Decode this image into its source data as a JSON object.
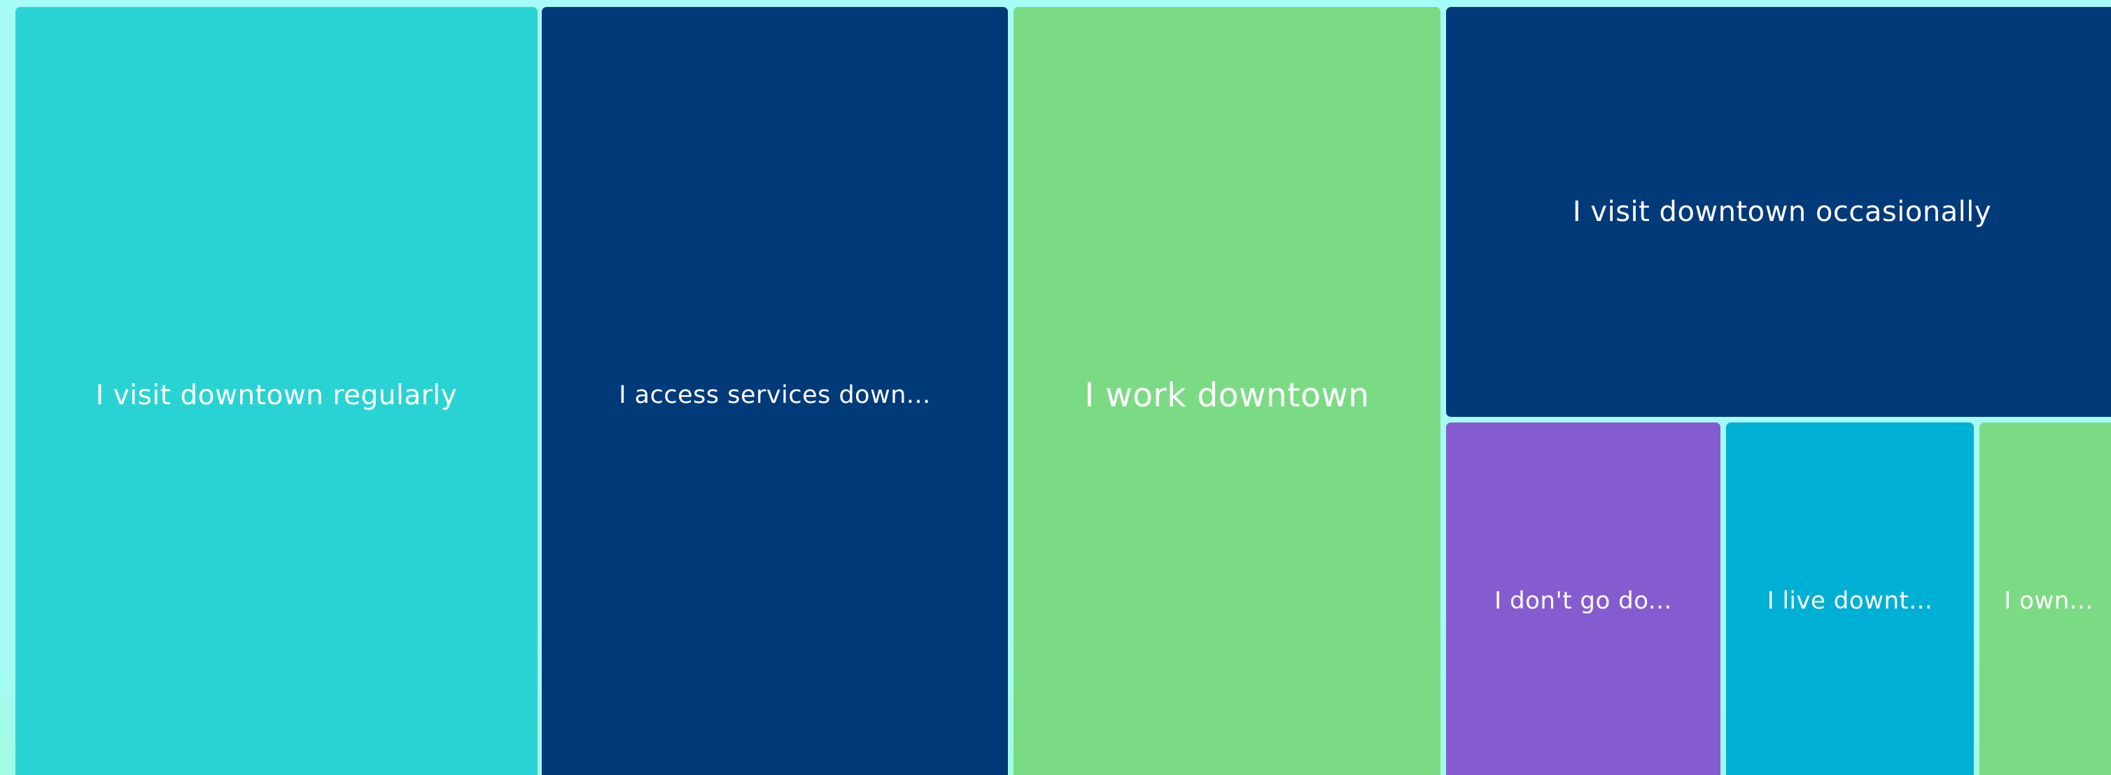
{
  "chart_data": {
    "type": "treemap",
    "title": "",
    "items": [
      {
        "label": "I visit downtown regularly",
        "display": "I visit downtown regularly",
        "color": "#29d3d3"
      },
      {
        "label": "I access services downtown",
        "display": "I access services down...",
        "color": "#003a79"
      },
      {
        "label": "I work downtown",
        "display": "I work downtown",
        "color": "#7bdb84"
      },
      {
        "label": "I visit downtown occasionally",
        "display": "I visit downtown occasionally",
        "color": "#003a79"
      },
      {
        "label": "I don't go downtown",
        "display": "I don't go do...",
        "color": "#855ccf"
      },
      {
        "label": "I live downtown",
        "display": "I live downt...",
        "color": "#00b0d4"
      },
      {
        "label": "I own a business downtown",
        "display": "I own...",
        "color": "#7bdb84"
      }
    ]
  }
}
